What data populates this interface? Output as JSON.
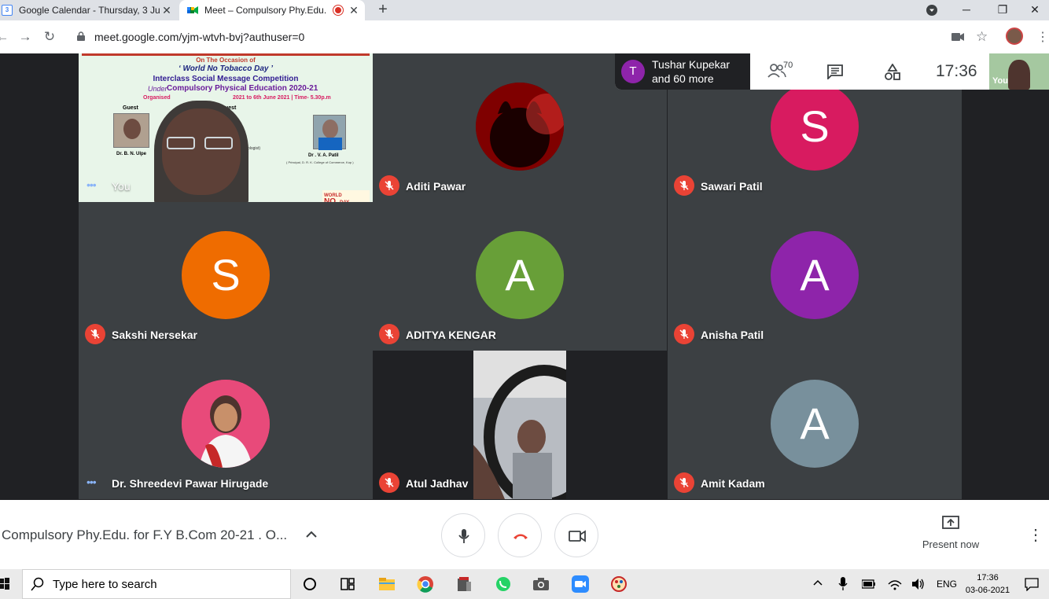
{
  "browser": {
    "tabs": [
      {
        "title": "Google Calendar - Thursday, 3 Ju",
        "favicon": "3"
      },
      {
        "title": "Meet – Compulsory Phy.Edu."
      }
    ],
    "url": "meet.google.com/yjm-wtvh-bvj?authuser=0"
  },
  "meet": {
    "presenter": {
      "initial": "T",
      "line1": "Tushar Kupekar",
      "line2": "and 60 more"
    },
    "participant_count": "70",
    "clock": "17:36",
    "self_thumb_label": "You",
    "participants": [
      {
        "name": "You",
        "type": "video"
      },
      {
        "name": "Aditi Pawar",
        "type": "image",
        "muted": true
      },
      {
        "name": "Sawari Patil",
        "type": "avatar",
        "initial": "S",
        "color": "#d81b60",
        "muted": true
      },
      {
        "name": "Sakshi Nersekar",
        "type": "avatar",
        "initial": "S",
        "color": "#ef6c00",
        "muted": true
      },
      {
        "name": "ADITYA KENGAR",
        "type": "avatar",
        "initial": "A",
        "color": "#689f38",
        "muted": true
      },
      {
        "name": "Anisha Patil",
        "type": "avatar",
        "initial": "A",
        "color": "#8e24aa",
        "muted": true
      },
      {
        "name": "Dr. Shreedevi Pawar Hirugade",
        "type": "image",
        "muted": false
      },
      {
        "name": "Atul Jadhav",
        "type": "video",
        "muted": true
      },
      {
        "name": "Amit Kadam",
        "type": "avatar",
        "initial": "A",
        "color": "#78909c",
        "muted": true
      }
    ],
    "poster": {
      "occasion": "On The Occasion of",
      "day": "‘ World No Tobacco Day ’",
      "competition": "Interclass Social Message Competition",
      "under": "Under",
      "program": "Compulsory Physical Education 2020-21",
      "organised": "Organised",
      "dates": "2021 to 6th June 2021 | Time- 5.30p.m",
      "guest1_label": "Guest",
      "guest2_label": "uest",
      "guest1_name": "Dr. B. N. Ulpe",
      "guest2_name": "Dr . V. A. Patil",
      "guest2_sub": "( Principal, D. R. K. College of Commerce, Kop )",
      "urologist": "(Urologist)",
      "logo_text": "WORLD NO TOBACCO DAY"
    },
    "meeting_title": "Compulsory Phy.Edu. for F.Y B.Com 20-21 . O...",
    "present_now": "Present now"
  },
  "taskbar": {
    "search_placeholder": "Type here to search",
    "lang": "ENG",
    "time": "17:36",
    "date": "03-06-2021"
  },
  "colors": {
    "meet_bg": "#202124",
    "tile_bg": "#3c4043",
    "mute_red": "#ea4335",
    "hangup_red": "#ea4335"
  }
}
